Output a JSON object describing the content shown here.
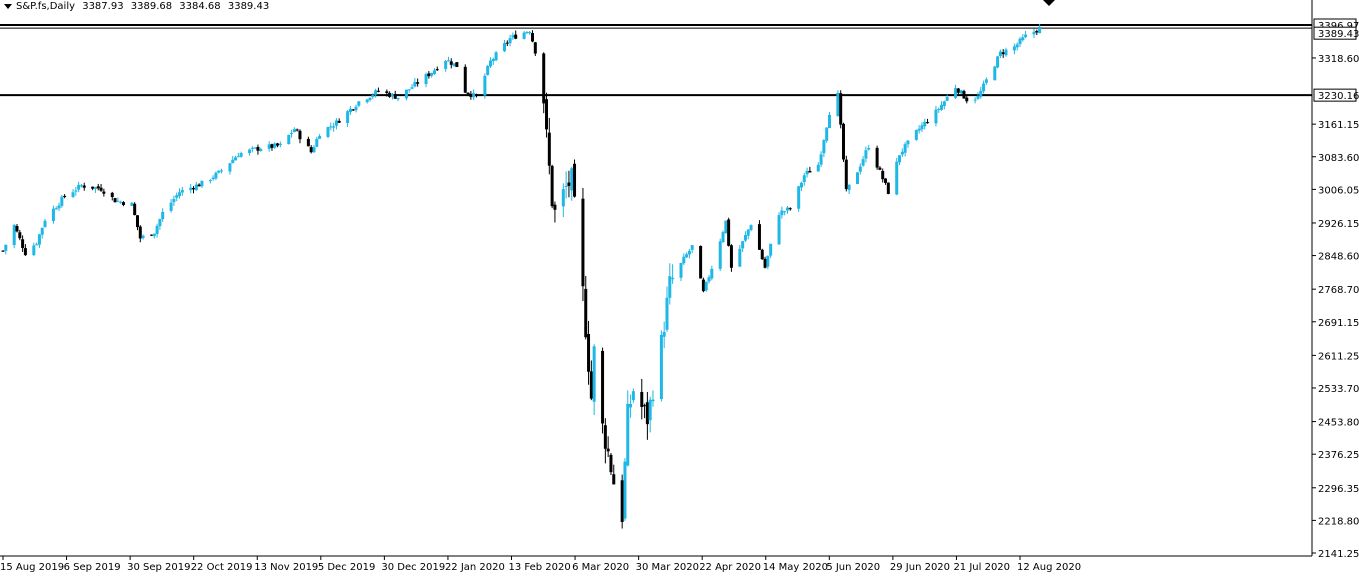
{
  "header": {
    "symbol": "S&P.fs,Daily",
    "open": "3387.93",
    "high": "3389.68",
    "low": "3384.68",
    "close": "3389.43"
  },
  "colors": {
    "bull": "#1fb7e6",
    "bear": "#000000",
    "background": "#ffffff",
    "axis": "#000000"
  },
  "chart_data": {
    "type": "candlestick",
    "title": "",
    "xlabel": "",
    "ylabel": "",
    "ylim": [
      2141.25,
      3396.97
    ],
    "y_ticks": [
      "3318.60",
      "3161.15",
      "3083.60",
      "3006.05",
      "2926.15",
      "2848.60",
      "2768.70",
      "2691.15",
      "2611.25",
      "2533.70",
      "2453.80",
      "2376.25",
      "2296.35",
      "2218.80",
      "2141.25"
    ],
    "x_ticks": [
      "15 Aug 2019",
      "6 Sep 2019",
      "30 Sep 2019",
      "22 Oct 2019",
      "13 Nov 2019",
      "5 Dec 2019",
      "30 Dec 2019",
      "22 Jan 2020",
      "13 Feb 2020",
      "6 Mar 2020",
      "30 Mar 2020",
      "22 Apr 2020",
      "14 May 2020",
      "5 Jun 2020",
      "29 Jun 2020",
      "21 Jul 2020",
      "12 Aug 2020"
    ],
    "horizontal_lines": [
      {
        "value": 3396.97,
        "label": "3396.97"
      },
      {
        "value": 3389.43,
        "label": "3389.43"
      },
      {
        "value": 3230.16,
        "label": "3230.16"
      }
    ],
    "anchors": [
      [
        "2019-08-15",
        2860
      ],
      [
        "2019-08-19",
        2920
      ],
      [
        "2019-08-23",
        2855
      ],
      [
        "2019-08-27",
        2880
      ],
      [
        "2019-08-30",
        2935
      ],
      [
        "2019-09-06",
        2990
      ],
      [
        "2019-09-12",
        3015
      ],
      [
        "2019-09-19",
        3008
      ],
      [
        "2019-09-24",
        2980
      ],
      [
        "2019-09-30",
        2970
      ],
      [
        "2019-10-03",
        2890
      ],
      [
        "2019-10-08",
        2905
      ],
      [
        "2019-10-11",
        2950
      ],
      [
        "2019-10-17",
        3000
      ],
      [
        "2019-10-25",
        3020
      ],
      [
        "2019-10-31",
        3045
      ],
      [
        "2019-11-07",
        3090
      ],
      [
        "2019-11-15",
        3105
      ],
      [
        "2019-11-22",
        3110
      ],
      [
        "2019-11-27",
        3150
      ],
      [
        "2019-12-03",
        3095
      ],
      [
        "2019-12-06",
        3140
      ],
      [
        "2019-12-12",
        3165
      ],
      [
        "2019-12-20",
        3215
      ],
      [
        "2019-12-27",
        3240
      ],
      [
        "2020-01-03",
        3225
      ],
      [
        "2020-01-08",
        3250
      ],
      [
        "2020-01-15",
        3285
      ],
      [
        "2020-01-20",
        3315
      ],
      [
        "2020-01-24",
        3300
      ],
      [
        "2020-01-27",
        3240
      ],
      [
        "2020-01-31",
        3225
      ],
      [
        "2020-02-05",
        3310
      ],
      [
        "2020-02-12",
        3365
      ],
      [
        "2020-02-19",
        3385
      ],
      [
        "2020-02-21",
        3335
      ],
      [
        "2020-02-24",
        3220
      ],
      [
        "2020-02-25",
        3130
      ],
      [
        "2020-02-27",
        2980
      ],
      [
        "2020-02-28",
        2950
      ],
      [
        "2020-03-03",
        3010
      ],
      [
        "2020-03-05",
        3030
      ],
      [
        "2020-03-09",
        2760
      ],
      [
        "2020-03-12",
        2510
      ],
      [
        "2020-03-13",
        2620
      ],
      [
        "2020-03-16",
        2440
      ],
      [
        "2020-03-18",
        2380
      ],
      [
        "2020-03-20",
        2310
      ],
      [
        "2020-03-23",
        2230
      ],
      [
        "2020-03-25",
        2470
      ],
      [
        "2020-03-27",
        2530
      ],
      [
        "2020-04-01",
        2460
      ],
      [
        "2020-04-06",
        2640
      ],
      [
        "2020-04-09",
        2780
      ],
      [
        "2020-04-14",
        2840
      ],
      [
        "2020-04-17",
        2870
      ],
      [
        "2020-04-21",
        2760
      ],
      [
        "2020-04-24",
        2820
      ],
      [
        "2020-04-29",
        2930
      ],
      [
        "2020-05-01",
        2820
      ],
      [
        "2020-05-08",
        2925
      ],
      [
        "2020-05-13",
        2820
      ],
      [
        "2020-05-18",
        2950
      ],
      [
        "2020-05-22",
        2960
      ],
      [
        "2020-05-27",
        3040
      ],
      [
        "2020-06-01",
        3065
      ],
      [
        "2020-06-05",
        3190
      ],
      [
        "2020-06-08",
        3230
      ],
      [
        "2020-06-11",
        3000
      ],
      [
        "2020-06-15",
        3050
      ],
      [
        "2020-06-19",
        3110
      ],
      [
        "2020-06-26",
        3000
      ],
      [
        "2020-06-30",
        3090
      ],
      [
        "2020-07-07",
        3150
      ],
      [
        "2020-07-13",
        3190
      ],
      [
        "2020-07-20",
        3250
      ],
      [
        "2020-07-24",
        3220
      ],
      [
        "2020-07-28",
        3225
      ],
      [
        "2020-07-31",
        3265
      ],
      [
        "2020-08-05",
        3330
      ],
      [
        "2020-08-10",
        3345
      ],
      [
        "2020-08-14",
        3370
      ],
      [
        "2020-08-19",
        3389
      ]
    ]
  }
}
